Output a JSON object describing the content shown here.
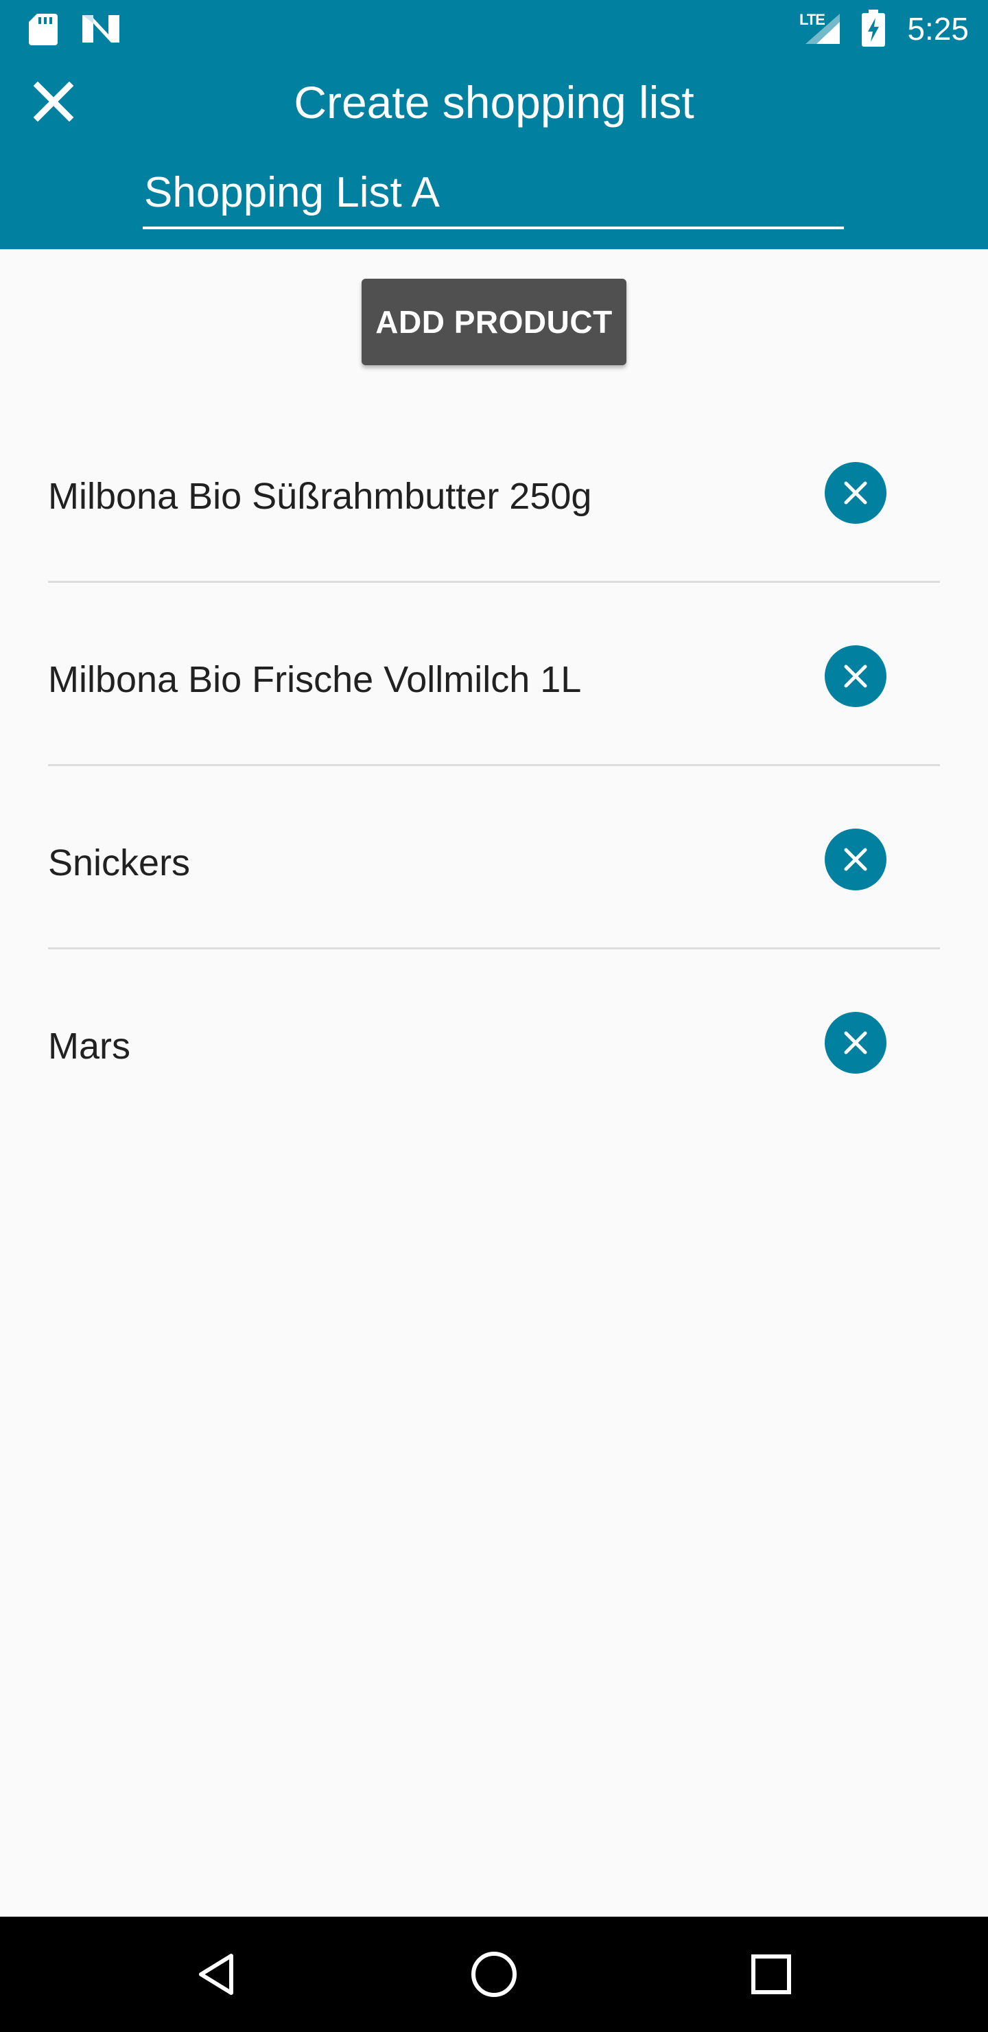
{
  "status_bar": {
    "time": "5:25",
    "network_label": "LTE",
    "icons": [
      "sd-card-icon",
      "notification-n-icon",
      "signal-icon",
      "battery-charging-icon"
    ]
  },
  "header": {
    "title": "Create shopping list",
    "close_icon": "close-icon",
    "list_name_value": "Shopping List A"
  },
  "actions": {
    "add_product_label": "ADD PRODUCT"
  },
  "products": [
    {
      "name": "Milbona Bio Süßrahmbutter 250g"
    },
    {
      "name": "Milbona Bio Frische Vollmilch 1L"
    },
    {
      "name": "Snickers"
    },
    {
      "name": "Mars"
    }
  ],
  "navigation": {
    "buttons": [
      "back-icon",
      "home-icon",
      "recents-icon"
    ]
  },
  "colors": {
    "primary": "#02809f",
    "button_dark": "#505050",
    "background": "#fafafa",
    "text": "#212121"
  }
}
